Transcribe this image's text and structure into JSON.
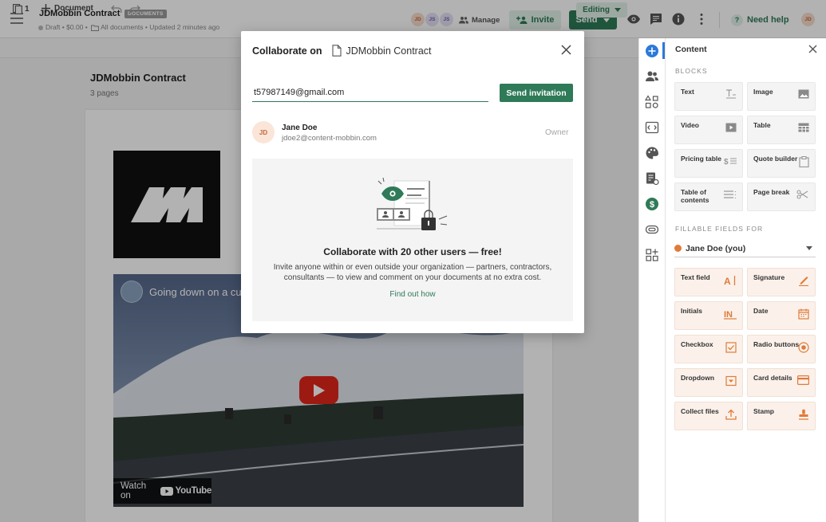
{
  "header": {
    "title": "JDMobbin Contract",
    "badge": "DOCUMENTS",
    "status": "Draft",
    "price": "$0.00",
    "folder": "All documents",
    "updated": "Updated 2 minutes ago",
    "avatars": [
      "JD",
      "JS",
      "JS"
    ],
    "manage_label": "Manage",
    "invite_label": "Invite",
    "send_label": "Send",
    "help_label": "Need help",
    "user_initials": "JD"
  },
  "toolbar": {
    "pages_count": "1",
    "add_document": "Document",
    "editing_label": "Editing"
  },
  "canvas": {
    "title": "JDMobbin Contract",
    "pages": "3 pages",
    "video_title": "Going down on a cu",
    "watch_on": "Watch on",
    "youtube": "YouTube"
  },
  "modal": {
    "title": "Collaborate on",
    "document_name": "JDMobbin Contract",
    "email_value": "t57987149@gmail.com",
    "send_invitation": "Send invitation",
    "member": {
      "initials": "JD",
      "name": "Jane Doe",
      "email": "jdoe2@content-mobbin.com",
      "role": "Owner"
    },
    "promo_heading": "Collaborate with 20 other users — free!",
    "promo_text": "Invite anyone within or even outside your organization — partners, contractors, consultants — to view and comment on your documents at no extra cost.",
    "promo_link": "Find out how"
  },
  "panel": {
    "title": "Content",
    "blocks_label": "BLOCKS",
    "blocks": [
      "Text",
      "Image",
      "Video",
      "Table",
      "Pricing table",
      "Quote builder",
      "Table of contents",
      "Page break"
    ],
    "fields_label": "FILLABLE FIELDS FOR",
    "recipient": "Jane Doe (you)",
    "fields": [
      "Text field",
      "Signature",
      "Initials",
      "Date",
      "Checkbox",
      "Radio buttons",
      "Dropdown",
      "Card details",
      "Collect files",
      "Stamp"
    ]
  },
  "colors": {
    "brand_green": "#2f7a58",
    "light_green": "#e3f1ea",
    "field_tile": "#fbf1ea",
    "field_icon": "#e07b39",
    "rail_active": "#2b7ad8"
  }
}
